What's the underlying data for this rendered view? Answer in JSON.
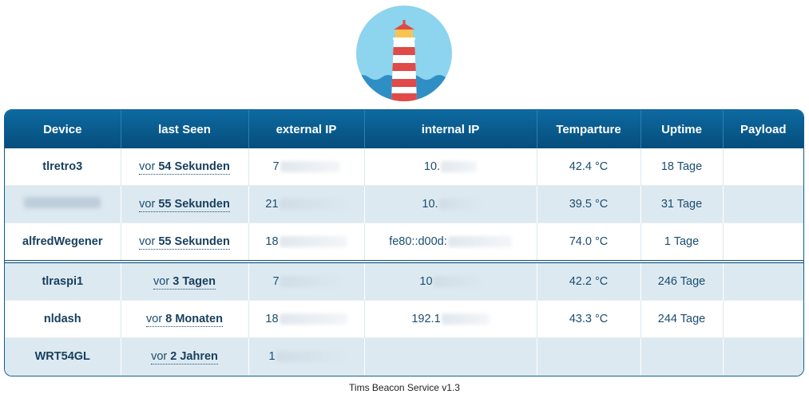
{
  "header": {
    "columns": [
      "Device",
      "last Seen",
      "external IP",
      "internal IP",
      "Temparture",
      "Uptime",
      "Payload"
    ]
  },
  "rows": [
    {
      "device": "tlretro3",
      "seen_prefix": "vor",
      "seen_value": "54 Sekunden",
      "ext_ip": "7",
      "int_ip": "10.",
      "temp": "42.4 °C",
      "uptime": "18 Tage",
      "payload": "",
      "style": "white",
      "sep": false,
      "redact_name": false
    },
    {
      "device": "",
      "seen_prefix": "vor",
      "seen_value": "55 Sekunden",
      "ext_ip": "21",
      "int_ip": "10.",
      "temp": "39.5 °C",
      "uptime": "31 Tage",
      "payload": "",
      "style": "blue",
      "sep": false,
      "redact_name": true
    },
    {
      "device": "alfredWegener",
      "seen_prefix": "vor",
      "seen_value": "55 Sekunden",
      "ext_ip": "18",
      "int_ip": "fe80::d00d:",
      "temp": "74.0 °C",
      "uptime": "1 Tage",
      "payload": "",
      "style": "white",
      "sep": false,
      "redact_name": false
    },
    {
      "device": "tlraspi1",
      "seen_prefix": "vor",
      "seen_value": "3 Tagen",
      "ext_ip": "7",
      "int_ip": "10",
      "temp": "42.2 °C",
      "uptime": "246 Tage",
      "payload": "",
      "style": "blue",
      "sep": true,
      "redact_name": false
    },
    {
      "device": "nldash",
      "seen_prefix": "vor",
      "seen_value": "8 Monaten",
      "ext_ip": "18",
      "int_ip": "192.1",
      "temp": "43.3 °C",
      "uptime": "244 Tage",
      "payload": "",
      "style": "white",
      "sep": false,
      "redact_name": false
    },
    {
      "device": "WRT54GL",
      "seen_prefix": "vor",
      "seen_value": "2 Jahren",
      "ext_ip": "1",
      "int_ip": "",
      "temp": "",
      "uptime": "",
      "payload": "",
      "style": "blue",
      "sep": false,
      "redact_name": false
    }
  ],
  "footer": "Tims Beacon Service v1.3",
  "colors": {
    "header_bg": "#0b5d8c",
    "row_alt": "#dde9f1",
    "text": "#1a4d70",
    "sky": "#8dd4ee",
    "sea": "#2f8fc4",
    "stripe_red": "#e04a48"
  },
  "icons": {
    "logo": "lighthouse-icon"
  }
}
